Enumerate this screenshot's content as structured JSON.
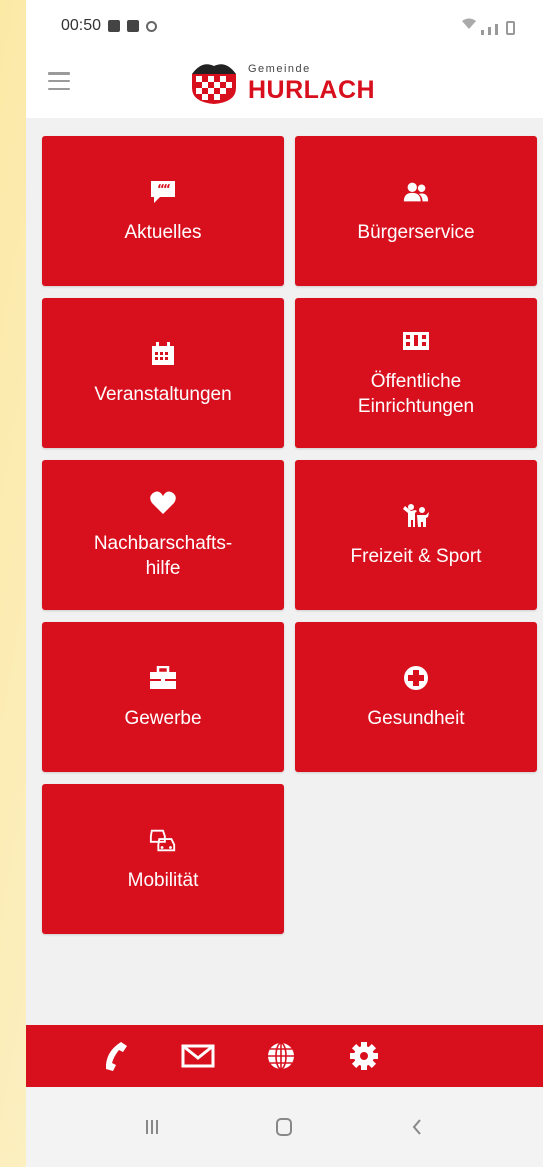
{
  "status_bar": {
    "time": "00:50"
  },
  "header": {
    "logo_small": "Gemeinde",
    "logo_big": "HURLACH"
  },
  "tiles": [
    {
      "label": "Aktuelles",
      "icon": "quote-bubble-icon"
    },
    {
      "label": "Bürgerservice",
      "icon": "users-icon"
    },
    {
      "label": "Veranstaltungen",
      "icon": "calendar-icon"
    },
    {
      "label": "Öffentliche\nEinrichtungen",
      "icon": "building-icon"
    },
    {
      "label": "Nachbarschafts-\nhilfe",
      "icon": "heart-icon"
    },
    {
      "label": "Freizeit & Sport",
      "icon": "children-play-icon"
    },
    {
      "label": "Gewerbe",
      "icon": "briefcase-icon"
    },
    {
      "label": "Gesundheit",
      "icon": "first-aid-icon"
    },
    {
      "label": "Mobilität",
      "icon": "cars-icon"
    }
  ],
  "bottom_bar": [
    {
      "icon": "phone-icon"
    },
    {
      "icon": "mail-icon"
    },
    {
      "icon": "globe-icon"
    },
    {
      "icon": "settings-gear-icon"
    }
  ],
  "nav_bar": [
    {
      "icon": "recent-apps-icon"
    },
    {
      "icon": "home-icon"
    },
    {
      "icon": "back-icon"
    }
  ],
  "colors": {
    "accent": "#d8101e",
    "background": "#f1f1f1"
  }
}
